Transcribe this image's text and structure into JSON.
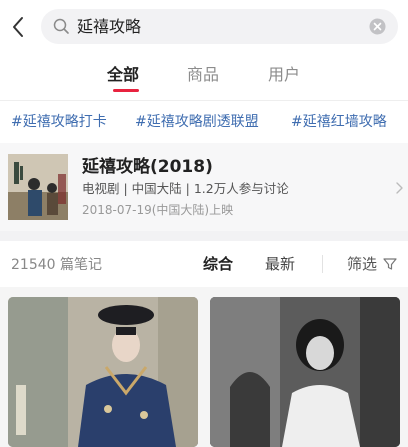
{
  "search": {
    "query": "延禧攻略"
  },
  "tabs": [
    {
      "label": "全部"
    },
    {
      "label": "商品"
    },
    {
      "label": "用户"
    }
  ],
  "hashtags": [
    "#延禧攻略打卡",
    "#延禧攻略剧透联盟",
    "#延禧红墙攻略"
  ],
  "drama_card": {
    "title": "延禧攻略(2018)",
    "meta": "电视剧 | 中国大陆 | 1.2万人参与讨论",
    "date": "2018-07-19(中国大陆)上映"
  },
  "notes_bar": {
    "count": "21540 篇笔记",
    "sort_all": "综合",
    "sort_new": "最新",
    "filter": "筛选"
  },
  "colors": {
    "accent": "#e8233f",
    "hashtag": "#3f6db0"
  }
}
